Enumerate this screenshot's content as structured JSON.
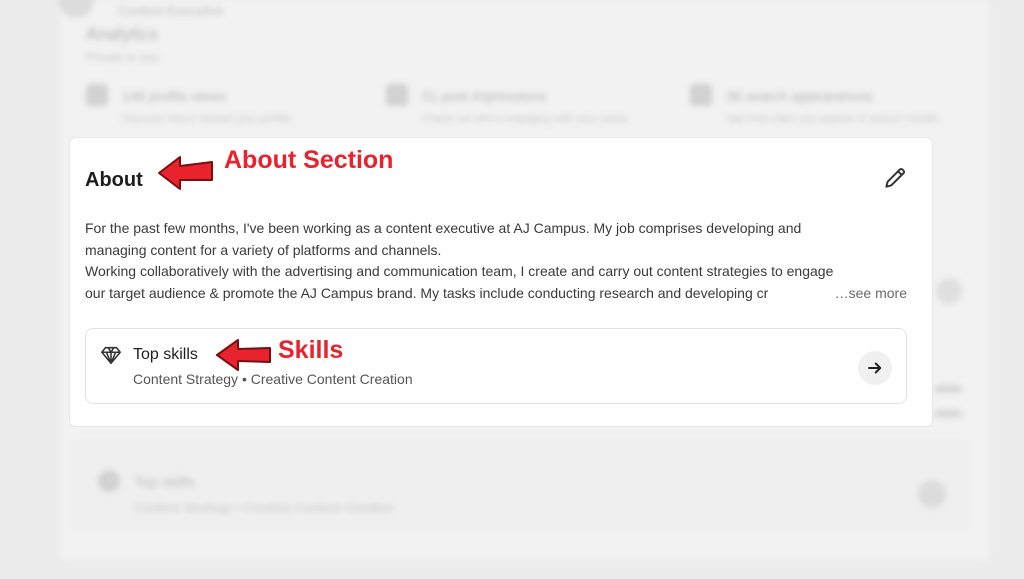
{
  "background": {
    "header_name": "Content Executive",
    "analytics_title": "Analytics",
    "analytics_sub": "Private to you",
    "stats": [
      {
        "title": "146 profile views",
        "sub": "Discover who's viewed your profile."
      },
      {
        "title": "51 post impressions",
        "sub": "Check out who's engaging with your posts."
      },
      {
        "title": "36 search appearances",
        "sub": "See how often you appear in search results."
      }
    ],
    "lower_skills_title": "Top skills",
    "lower_skills_list": "Content Strategy • Creative Content Creation"
  },
  "about": {
    "title": "About",
    "lines": [
      "For the past few months, I've been working as a content executive at AJ Campus. My job comprises developing and",
      "managing content for a variety of platforms and channels.",
      "Working collaboratively with the advertising and communication team, I create and carry out content strategies to engage",
      "our target audience & promote the AJ Campus brand. My tasks include conducting research and developing cr"
    ],
    "see_more": "…see more",
    "edit_icon": "pencil-icon"
  },
  "top_skills": {
    "title": "Top skills",
    "list": "Content Strategy • Creative Content Creation",
    "icon": "diamond-icon",
    "action_icon": "arrow-right-icon"
  },
  "annotations": {
    "about_label": "About Section",
    "skills_label": "Skills",
    "color": "#e8232d"
  }
}
